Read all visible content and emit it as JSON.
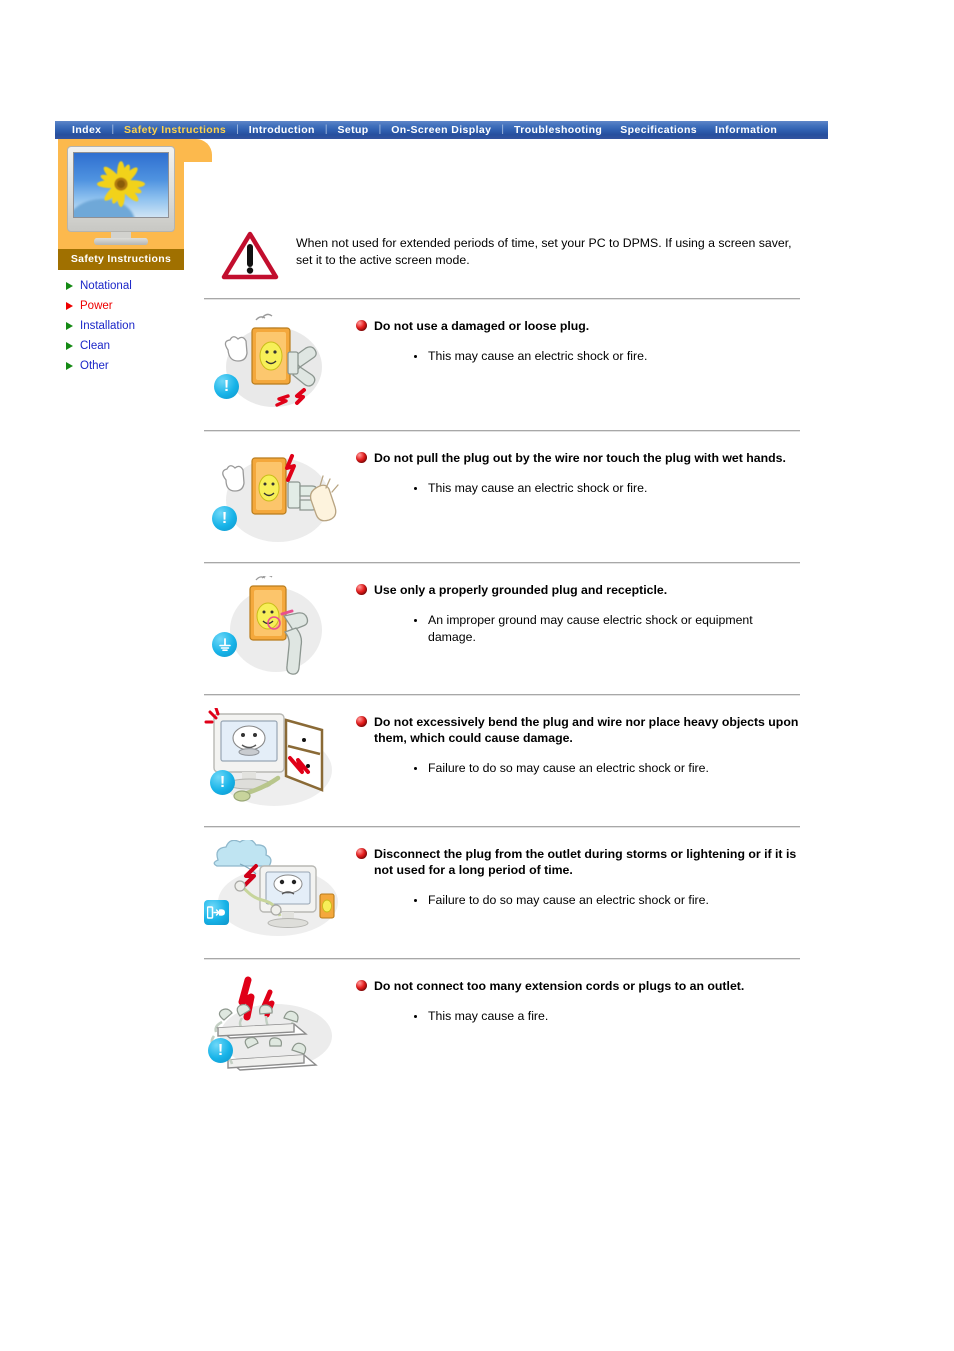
{
  "nav": {
    "items": [
      {
        "label": "Index",
        "active": false
      },
      {
        "label": "Safety Instructions",
        "active": true
      },
      {
        "label": "Introduction",
        "active": false
      },
      {
        "label": "Setup",
        "active": false
      },
      {
        "label": "On-Screen Display",
        "active": false
      },
      {
        "label": "Troubleshooting",
        "active": false
      },
      {
        "label": "Specifications",
        "active": false
      },
      {
        "label": "Information",
        "active": false
      }
    ],
    "separator": "|",
    "bg_color": "#2f5fb0",
    "active_color": "#ffd24a"
  },
  "sidebar": {
    "title": "Safety Instructions",
    "title_bg": "#a07000",
    "panel_bg": "#fcb94d",
    "thumbnail_alt": "monitor-sunflower",
    "items": [
      {
        "label": "Notational",
        "selected": false
      },
      {
        "label": "Power",
        "selected": true
      },
      {
        "label": "Installation",
        "selected": false
      },
      {
        "label": "Clean",
        "selected": false
      },
      {
        "label": "Other",
        "selected": false
      }
    ],
    "link_color": "#1b26c8",
    "selected_color": "#ee0000",
    "marker_color": "#148a14"
  },
  "content": {
    "note": {
      "icon": "warning-triangle-icon",
      "text": "When not used for extended periods of time, set your PC to DPMS. If using a screen saver, set it to the active screen mode."
    },
    "items": [
      {
        "heading": "Do not use a damaged or loose plug.",
        "detail": "This may cause an electric shock or fire.",
        "illustration": "damaged-plug-illustration",
        "badge": "exclamation-badge-icon"
      },
      {
        "heading": "Do not pull the plug out by the wire nor touch the plug with wet hands.",
        "detail": "This may cause an electric shock or fire.",
        "illustration": "wet-hands-plug-illustration",
        "badge": "exclamation-badge-icon"
      },
      {
        "heading": "Use only a properly grounded plug and recepticle.",
        "detail": "An improper ground may cause electric shock or equipment damage.",
        "illustration": "grounded-plug-illustration",
        "badge": "ground-badge-icon"
      },
      {
        "heading": "Do not excessively bend the plug and wire nor place heavy objects upon them, which could cause damage.",
        "detail": "Failure to do so may cause an electric shock or fire.",
        "illustration": "bent-wire-monitor-illustration",
        "badge": "exclamation-badge-icon"
      },
      {
        "heading": "Disconnect the plug from the outlet during storms or lightening or if it is not used for a long period of time.",
        "detail": "Failure to do so may cause an electric shock or fire.",
        "illustration": "storm-unplug-illustration",
        "badge": "unplug-badge-icon"
      },
      {
        "heading": "Do not connect too many extension cords or plugs to an outlet.",
        "detail": "This may cause a fire.",
        "illustration": "extension-cords-illustration",
        "badge": "exclamation-badge-icon"
      }
    ]
  }
}
